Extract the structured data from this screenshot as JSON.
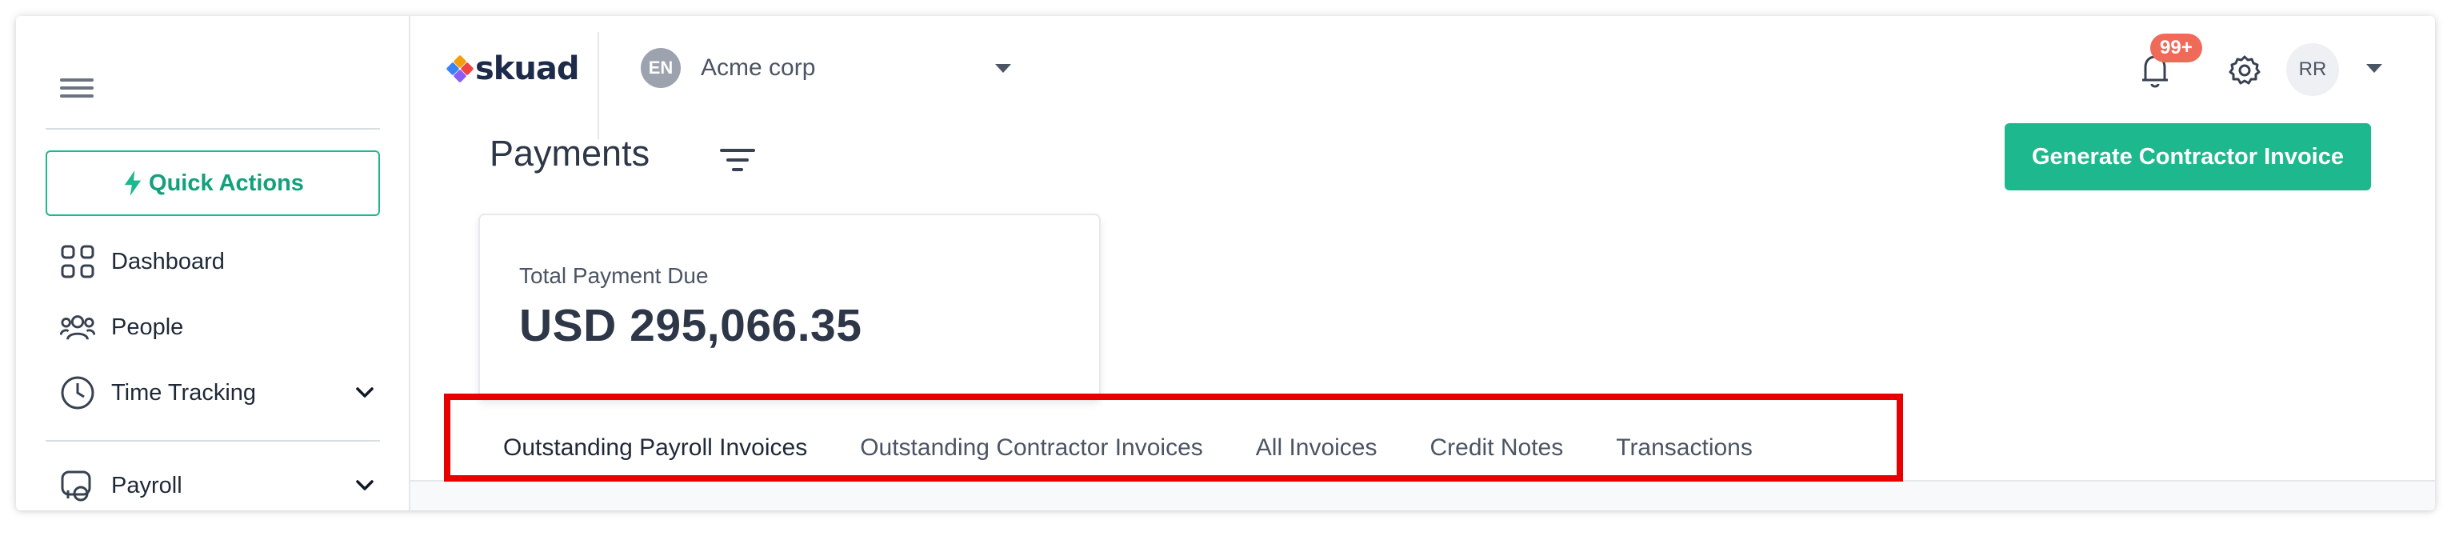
{
  "sidebar": {
    "quick_actions_label": "Quick Actions",
    "items": [
      {
        "label": "Dashboard",
        "icon": "grid-icon"
      },
      {
        "label": "People",
        "icon": "people-icon"
      },
      {
        "label": "Time Tracking",
        "icon": "clock-icon",
        "expandable": true
      },
      {
        "label": "Payroll",
        "icon": "payroll-icon",
        "expandable": true
      }
    ]
  },
  "header": {
    "logo_text": "skuad",
    "org_initials": "EN",
    "org_name": "Acme corp",
    "notification_count": "99+",
    "user_initials": "RR"
  },
  "page": {
    "title": "Payments",
    "generate_button_label": "Generate Contractor Invoice"
  },
  "summary_card": {
    "label": "Total Payment Due",
    "value": "USD 295,066.35"
  },
  "tabs": [
    {
      "label": "Outstanding Payroll Invoices",
      "active": true
    },
    {
      "label": "Outstanding Contractor Invoices",
      "active": false
    },
    {
      "label": "All Invoices",
      "active": false
    },
    {
      "label": "Credit Notes",
      "active": false
    },
    {
      "label": "Transactions",
      "active": false
    }
  ],
  "colors": {
    "accent": "#1db88e",
    "notification_badge": "#f06a5a",
    "highlight_box": "#e80000"
  }
}
